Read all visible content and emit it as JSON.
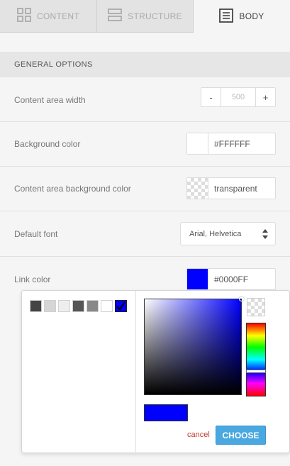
{
  "tabs": [
    {
      "label": "CONTENT",
      "icon": "grid-icon"
    },
    {
      "label": "STRUCTURE",
      "icon": "rows-icon"
    },
    {
      "label": "BODY",
      "icon": "document-icon"
    }
  ],
  "section": {
    "title": "GENERAL OPTIONS"
  },
  "rows": {
    "content_width": {
      "label": "Content area width",
      "minus": "-",
      "value": "500",
      "plus": "+"
    },
    "background_color": {
      "label": "Background color",
      "value": "#FFFFFF",
      "swatch": "#ffffff"
    },
    "content_bg_color": {
      "label": "Content area background color",
      "value": "transparent"
    },
    "default_font": {
      "label": "Default font",
      "value": "Arial, Helvetica"
    },
    "link_color": {
      "label": "Link color",
      "value": "#0000FF",
      "swatch": "#0000ff"
    }
  },
  "picker": {
    "palette": [
      "#444444",
      "#d6d6d6",
      "#eeeeee",
      "#555555",
      "#888888",
      "#ffffff",
      "#0000ff"
    ],
    "selected_index": 6,
    "current_color": "#0000ff",
    "cancel_label": "cancel",
    "choose_label": "CHOOSE"
  },
  "colors": {
    "accent": "#4aa8e0",
    "cancel": "#c0392b"
  }
}
